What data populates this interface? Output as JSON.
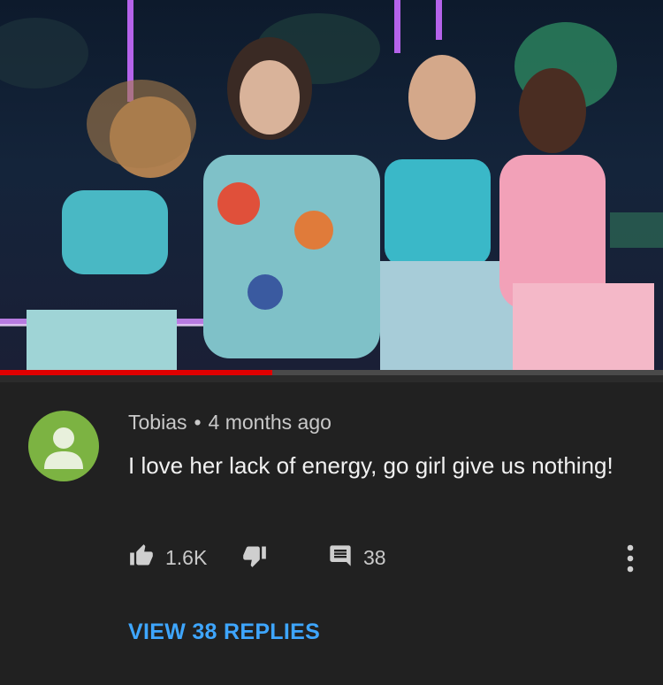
{
  "video": {
    "progress_fraction": 0.41
  },
  "comment": {
    "author": "Tobias",
    "separator": "•",
    "time": "4 months ago",
    "text": "I love her lack of energy, go girl give us nothing!",
    "like_count": "1.6K",
    "reply_count": "38",
    "view_replies_label": "VIEW 38 REPLIES"
  },
  "icons": {
    "like": "thumbs-up-icon",
    "dislike": "thumbs-down-icon",
    "reply": "comment-icon",
    "more": "more-vertical-icon",
    "avatar": "user-avatar-icon"
  },
  "colors": {
    "background": "#212121",
    "avatar_bg": "#7cb342",
    "link": "#3ea6ff",
    "progress": "#e00000"
  }
}
